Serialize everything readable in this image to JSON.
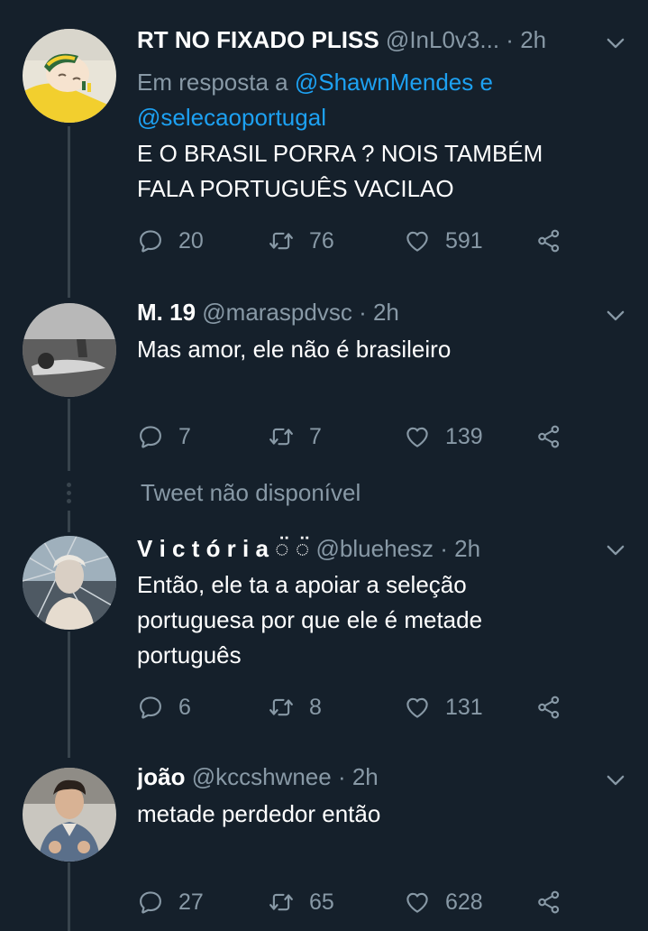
{
  "tweets": [
    {
      "name": "RT NO FIXADO PLISS",
      "handle": "@InL0v3...",
      "time": "2h",
      "reply_prefix": "Em resposta a ",
      "mention_1": "@ShawnMendes",
      "mention_join": " e",
      "mention_2": "@selecaoportugal",
      "text": "E O BRASIL PORRA ? NOIS TAMBÉM FALA PORTUGUÊS VACILAO",
      "replies": "20",
      "retweets": "76",
      "likes": "591"
    },
    {
      "name": "M. 19",
      "handle": "@maraspdvsc",
      "time": "2h",
      "text": "Mas amor, ele não é brasileiro",
      "replies": "7",
      "retweets": "7",
      "likes": "139"
    },
    {
      "name": "V i c t ó r i a ◌̈ ◌̈",
      "handle": "@bluehesz",
      "time": "2h",
      "text": "Então, ele ta a apoiar a seleção portuguesa por que ele é metade português",
      "replies": "6",
      "retweets": "8",
      "likes": "131"
    },
    {
      "name": "joão",
      "handle": "@kccshwnee",
      "time": "2h",
      "text": "metade perdedor então",
      "replies": "27",
      "retweets": "65",
      "likes": "628"
    }
  ],
  "unavailable_label": "Tweet não disponível",
  "separator": "·",
  "colors": {
    "background": "#15202b",
    "text_primary": "#ffffff",
    "text_secondary": "#8899a6",
    "link": "#1da1f2",
    "divider": "#38444d"
  },
  "icons": {
    "reply": "reply-icon",
    "retweet": "retweet-icon",
    "like": "heart-icon",
    "share": "share-icon",
    "menu": "chevron-down-icon"
  }
}
